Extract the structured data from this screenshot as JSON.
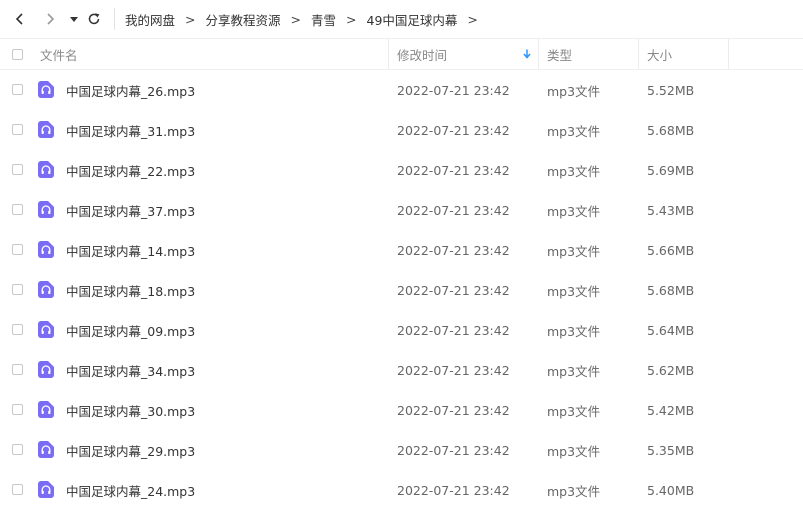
{
  "nav": {
    "back_icon": "chevron-left-icon",
    "forward_icon": "chevron-right-icon",
    "dropdown_icon": "caret-down-icon",
    "refresh_icon": "refresh-icon"
  },
  "breadcrumb": [
    "我的网盘",
    "分享教程资源",
    "青雪",
    "49中国足球内幕"
  ],
  "breadcrumb_separator": ">",
  "columns": {
    "name": "文件名",
    "modified": "修改时间",
    "type": "类型",
    "size": "大小",
    "sort_icon": "arrow-down-icon",
    "sort_color": "#1e90ff"
  },
  "file_icon": {
    "name": "audio-file-icon",
    "color": "#7b6cf6"
  },
  "files": [
    {
      "name": "中国足球内幕_26.mp3",
      "modified": "2022-07-21 23:42",
      "type": "mp3文件",
      "size": "5.52MB"
    },
    {
      "name": "中国足球内幕_31.mp3",
      "modified": "2022-07-21 23:42",
      "type": "mp3文件",
      "size": "5.68MB"
    },
    {
      "name": "中国足球内幕_22.mp3",
      "modified": "2022-07-21 23:42",
      "type": "mp3文件",
      "size": "5.69MB"
    },
    {
      "name": "中国足球内幕_37.mp3",
      "modified": "2022-07-21 23:42",
      "type": "mp3文件",
      "size": "5.43MB"
    },
    {
      "name": "中国足球内幕_14.mp3",
      "modified": "2022-07-21 23:42",
      "type": "mp3文件",
      "size": "5.66MB"
    },
    {
      "name": "中国足球内幕_18.mp3",
      "modified": "2022-07-21 23:42",
      "type": "mp3文件",
      "size": "5.68MB"
    },
    {
      "name": "中国足球内幕_09.mp3",
      "modified": "2022-07-21 23:42",
      "type": "mp3文件",
      "size": "5.64MB"
    },
    {
      "name": "中国足球内幕_34.mp3",
      "modified": "2022-07-21 23:42",
      "type": "mp3文件",
      "size": "5.62MB"
    },
    {
      "name": "中国足球内幕_30.mp3",
      "modified": "2022-07-21 23:42",
      "type": "mp3文件",
      "size": "5.42MB"
    },
    {
      "name": "中国足球内幕_29.mp3",
      "modified": "2022-07-21 23:42",
      "type": "mp3文件",
      "size": "5.35MB"
    },
    {
      "name": "中国足球内幕_24.mp3",
      "modified": "2022-07-21 23:42",
      "type": "mp3文件",
      "size": "5.40MB"
    }
  ]
}
